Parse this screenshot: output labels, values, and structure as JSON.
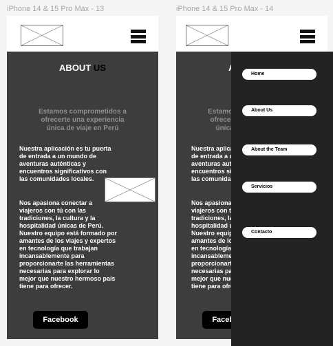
{
  "frames": [
    {
      "label": "iPhone 14 & 15 Pro Max - 13"
    },
    {
      "label": "iPhone 14 & 15 Pro Max - 14"
    }
  ],
  "about": {
    "title_main": "ABOUT ",
    "title_accent": "US",
    "subtitle": "Estamos comprometidos a ofrecerte una experiencia única de viaje en Perú",
    "paragraph_1": "Nuestra aplicación es tu puerta de entrada a un mundo de aventuras auténticas y encuentros significativos con las comunidades locales.",
    "paragraph_2": "Nos apasiona conectar a viajeros con tú con las tradiciones, la cultura y la hospitalidad únicas de Perú. Nuestro equipo está formado por amantes de los viajes y expertos en tecnología que trabajan incansablemente para proporcionarte las herramientas necesarias para explorar lo mejor que nuestro hermoso país tiene para ofrecer.",
    "facebook_label": "Facebook"
  },
  "menu": {
    "items": [
      {
        "label": "Home"
      },
      {
        "label": "About Us"
      },
      {
        "label": "About the Team"
      },
      {
        "label": "Servicios"
      },
      {
        "label": "Contacto"
      }
    ]
  },
  "colors": {
    "content_bg": "#3d3d3d",
    "menu_bg": "#232323",
    "subtitle_text": "#8f8f8f",
    "button_bg": "#000000"
  }
}
